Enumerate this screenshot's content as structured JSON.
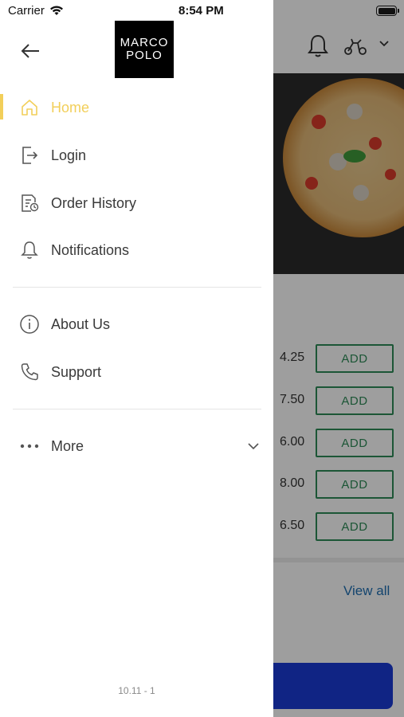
{
  "status_bar": {
    "carrier": "Carrier",
    "time": "8:54 PM"
  },
  "logo": {
    "line1": "MARCO",
    "line2": "POLO"
  },
  "drawer": {
    "items": [
      {
        "label": "Home",
        "icon": "home-icon",
        "active": true
      },
      {
        "label": "Login",
        "icon": "login-icon"
      },
      {
        "label": "Order History",
        "icon": "order-history-icon"
      },
      {
        "label": "Notifications",
        "icon": "bell-icon"
      },
      {
        "label": "About Us",
        "icon": "info-icon"
      },
      {
        "label": "Support",
        "icon": "phone-icon"
      },
      {
        "label": "More",
        "icon": "more-dots-icon"
      }
    ],
    "version": "10.11 - 1",
    "accent": "#f2cf5a"
  },
  "background": {
    "prices": [
      "4.25",
      "7.50",
      "6.00",
      "8.00",
      "6.50"
    ],
    "add_label": "ADD",
    "view_all": "View all"
  }
}
